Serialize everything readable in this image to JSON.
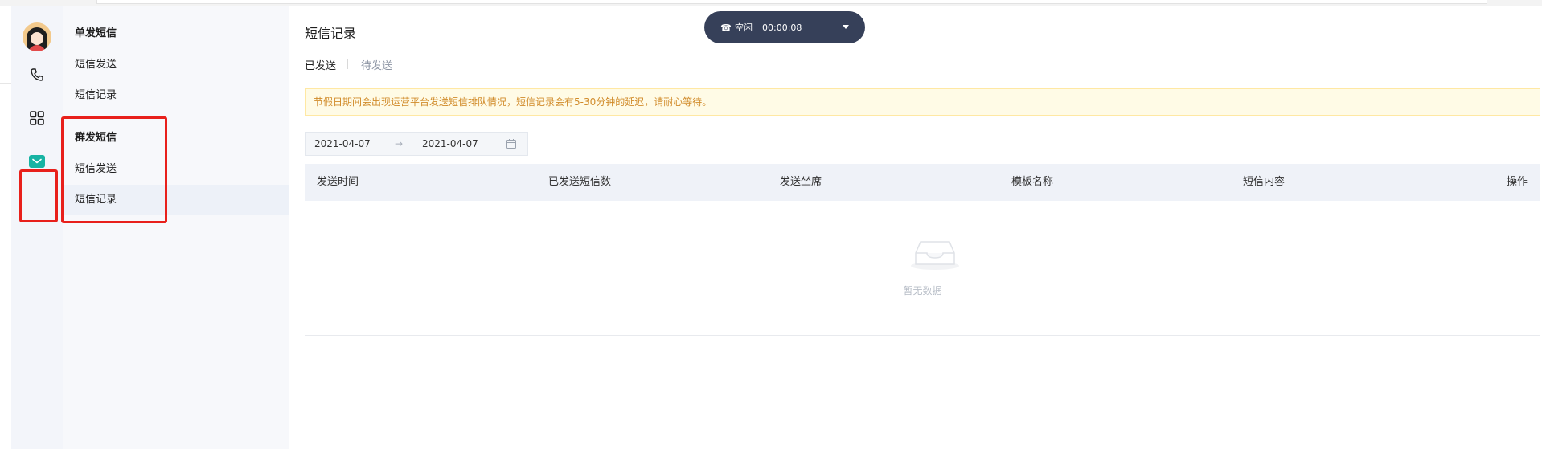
{
  "menu": {
    "single_title": "单发短信",
    "single_items": [
      "短信发送",
      "短信记录"
    ],
    "group_title": "群发短信",
    "group_items": [
      "短信发送",
      "短信记录"
    ]
  },
  "callbar": {
    "phone_glyph": "☎",
    "status": "空闲",
    "timer": "00:00:08"
  },
  "page": {
    "title": "短信记录",
    "tabs": [
      "已发送",
      "待发送"
    ]
  },
  "notice": "节假日期间会出现运营平台发送短信排队情况，短信记录会有5-30分钟的延迟，请耐心等待。",
  "daterange": {
    "start": "2021-04-07",
    "arrow": "→",
    "end": "2021-04-07"
  },
  "table": {
    "columns": [
      "发送时间",
      "已发送短信数",
      "发送坐席",
      "模板名称",
      "短信内容",
      "操作"
    ],
    "empty_text": "暂无数据"
  },
  "colors": {
    "accent": "#17b3a3",
    "highlight": "#e8201b",
    "callbar": "#364059"
  },
  "icons": {
    "phone": "phone-icon",
    "apps": "grid-icon",
    "mail": "mail-icon",
    "calendar": "calendar-icon",
    "empty": "inbox-empty-icon"
  }
}
